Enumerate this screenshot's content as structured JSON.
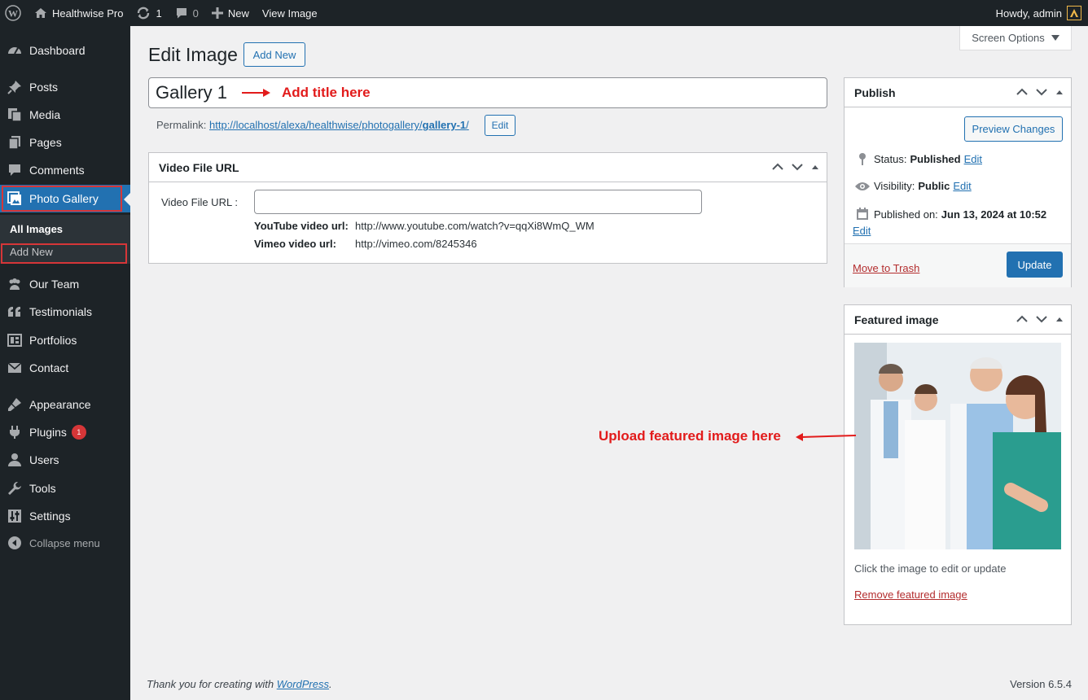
{
  "adminbar": {
    "site_name": "Healthwise Pro",
    "updates_count": "1",
    "comments_count": "0",
    "new_label": "New",
    "view_label": "View Image",
    "howdy": "Howdy, admin"
  },
  "sidebar": {
    "items": [
      {
        "label": "Dashboard",
        "icon": "dashboard-icon"
      },
      {
        "label": "Posts",
        "icon": "pin-icon"
      },
      {
        "label": "Media",
        "icon": "media-icon"
      },
      {
        "label": "Pages",
        "icon": "pages-icon"
      },
      {
        "label": "Comments",
        "icon": "comment-icon"
      },
      {
        "label": "Photo Gallery",
        "icon": "gallery-icon"
      },
      {
        "label": "Our Team",
        "icon": "team-icon"
      },
      {
        "label": "Testimonials",
        "icon": "quote-icon"
      },
      {
        "label": "Portfolios",
        "icon": "portfolio-icon"
      },
      {
        "label": "Contact",
        "icon": "mail-icon"
      },
      {
        "label": "Appearance",
        "icon": "brush-icon"
      },
      {
        "label": "Plugins",
        "icon": "plugin-icon"
      },
      {
        "label": "Users",
        "icon": "user-icon"
      },
      {
        "label": "Tools",
        "icon": "wrench-icon"
      },
      {
        "label": "Settings",
        "icon": "settings-icon"
      }
    ],
    "plugins_badge": "1",
    "submenu": {
      "all_images": "All Images",
      "add_new": "Add New"
    },
    "collapse": "Collapse menu"
  },
  "main": {
    "screen_options": "Screen Options",
    "page_title": "Edit Image",
    "add_new_button": "Add New",
    "title_value": "Gallery 1",
    "title_annotation": "Add title here",
    "permalink_label": "Permalink:",
    "permalink_url": "http://localhost/alexa/healthwise/photogallery/",
    "permalink_slug": "gallery-1",
    "permalink_trailing": "/",
    "permalink_edit": "Edit",
    "video_box": {
      "title": "Video File URL",
      "field_label": "Video File URL :",
      "field_value": "",
      "youtube_label": "YouTube video url:",
      "youtube_example": "http://www.youtube.com/watch?v=qqXi8WmQ_WM",
      "vimeo_label": "Vimeo video url:",
      "vimeo_example": "http://vimeo.com/8245346"
    },
    "featured_annotation": "Upload featured image here"
  },
  "publish": {
    "title": "Publish",
    "preview_button": "Preview Changes",
    "status_label": "Status:",
    "status_value": "Published",
    "visibility_label": "Visibility:",
    "visibility_value": "Public",
    "published_label": "Published on:",
    "published_value": "Jun 13, 2024 at 10:52",
    "edit_link": "Edit",
    "trash_link": "Move to Trash",
    "update_button": "Update"
  },
  "featured": {
    "title": "Featured image",
    "caption": "Click the image to edit or update",
    "remove_link": "Remove featured image"
  },
  "footer": {
    "thanks_prefix": "Thank you for creating with ",
    "wp_link": "WordPress",
    "thanks_suffix": ".",
    "version": "Version 6.5.4"
  },
  "colors": {
    "admin_bar": "#1d2327",
    "accent": "#2271b1",
    "annotation_red": "#e21b1b",
    "trash_red": "#b32d2e"
  }
}
